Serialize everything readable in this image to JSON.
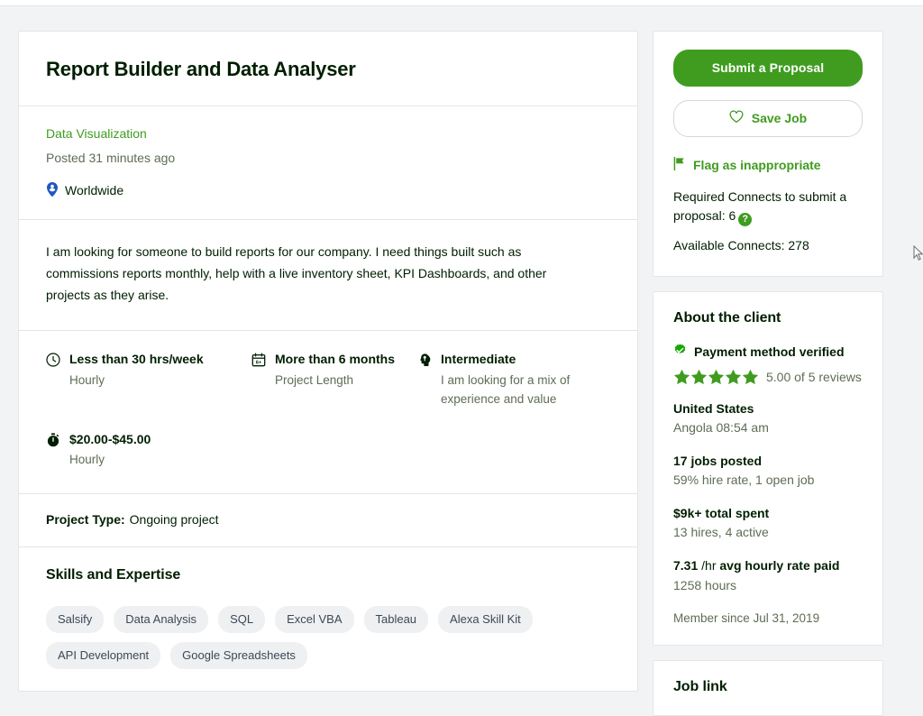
{
  "job": {
    "title": "Report Builder and Data Analyser",
    "category": "Data Visualization",
    "posted": "Posted 31 minutes ago",
    "location": "Worldwide",
    "location_icon": "location-person-icon",
    "description": "I am looking for someone to build reports for our company. I need things built such as commissions reports monthly, help with a live inventory sheet, KPI Dashboards, and other projects as they arise.",
    "facts": [
      {
        "icon": "clock-icon",
        "main": "Less than 30 hrs/week",
        "sub": "Hourly"
      },
      {
        "icon": "calendar-icon",
        "main": "More than 6 months",
        "sub": "Project Length"
      },
      {
        "icon": "expertise-icon",
        "main": "Intermediate",
        "sub": "I am looking for a mix of experience and value"
      },
      {
        "icon": "stopwatch-icon",
        "main": "$20.00-$45.00",
        "sub": "Hourly"
      }
    ],
    "project_type_label": "Project Type:",
    "project_type_value": "Ongoing project",
    "skills_heading": "Skills and Expertise",
    "skills": [
      "Salsify",
      "Data Analysis",
      "SQL",
      "Excel VBA",
      "Tableau",
      "Alexa Skill Kit",
      "API Development",
      "Google Spreadsheets"
    ]
  },
  "actions": {
    "submit_label": "Submit a Proposal",
    "save_label": "Save Job",
    "save_icon": "heart-icon",
    "flag_label": "Flag as inappropriate",
    "flag_icon": "flag-icon",
    "required_connects": "Required Connects to submit a proposal: 6",
    "help_icon": "question-mark-icon",
    "available_connects": "Available Connects: 278"
  },
  "client": {
    "heading": "About the client",
    "verified_label": "Payment method verified",
    "verified_icon": "check-badge-icon",
    "stars_filled": 5,
    "rating_text": "5.00 of 5 reviews",
    "country": "United States",
    "local_time": "Angola 08:54 am",
    "stats": [
      {
        "primary": "17 jobs posted",
        "secondary": "59% hire rate, 1 open job"
      },
      {
        "primary": "$9k+ total spent",
        "secondary": "13 hires, 4 active"
      }
    ],
    "rate_value": "7.31",
    "rate_unit": "/hr",
    "rate_label": "avg hourly rate paid",
    "rate_hours": "1258 hours",
    "member_since": "Member since Jul 31, 2019"
  },
  "job_link": {
    "heading": "Job link"
  },
  "colors": {
    "brand_green": "#3f9c1f",
    "text_dark": "#001e00",
    "text_muted": "#5e6d55",
    "tag_bg": "#eef0f2",
    "page_bg": "#f2f3f4",
    "link_blue": "#1f57c3"
  }
}
